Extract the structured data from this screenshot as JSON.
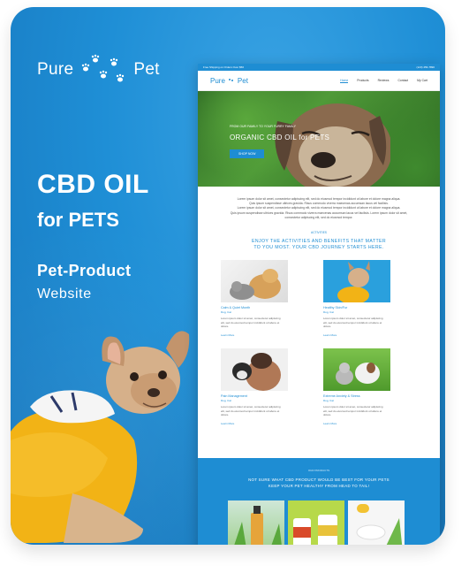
{
  "promo": {
    "logo_word1": "Pure",
    "logo_word2": "Pet",
    "headline1": "CBD OIL",
    "headline2": "for PETS",
    "sub1": "Pet-Product",
    "sub2": "Website"
  },
  "site": {
    "topbar_left": "Free Shipping on Orders Over $50",
    "topbar_right": "(123) 456-7890",
    "brand1": "Pure",
    "brand2": "Pet",
    "nav": [
      "Home",
      "Products",
      "Reviews",
      "Contact",
      "My Cart"
    ],
    "hero_small": "FROM OUR FAMILY TO YOUR FURRY FAMILY",
    "hero_big": "ORGANIC CBD OIL for PETS",
    "hero_button": "SHOP NOW",
    "intro": [
      "Lorem ipsum dolor sit amet, consectetur adipiscing elit, sed do eiusmod tempor incididunt ut labore et dolore magna aliqua.",
      "Quis ipsum suspendisse ultrices gravida. Risus commodo viverra maecenas accumsan lacus vel facilisis.",
      "Lorem ipsum dolor sit amet, consectetur adipiscing elit, sed do eiusmod tempor incididunt ut labore et dolore magna aliqua.",
      "Quis ipsum suspendisse ultrices gravida. Risus commodo viverra maecenas accumsan lacus vel facilisis. Lorem ipsum dolor sit amet, consectetur adipiscing elit, sed do eiusmod tempor."
    ],
    "section_label": "ACTIVITIES",
    "section_title_1": "ENJOY THE ACTIVITIES AND BENEFITS THAT MATTER",
    "section_title_2": "TO YOU MOST. YOUR CBD JOURNEY STARTS HERE.",
    "items": [
      {
        "title": "Calm & Quiet Month",
        "cat": "Dog, Cat",
        "desc": "Lorem ipsum dolor sit amet, consectetur adipiscing elit, sed do eiusmod tempor incididunt ut labore et dolore.",
        "more": "Learn More"
      },
      {
        "title": "Healthy Skin/Fur",
        "cat": "Dog, Cat",
        "desc": "Lorem ipsum dolor sit amet, consectetur adipiscing elit, sed do eiusmod tempor incididunt ut labore et dolore.",
        "more": "Learn More"
      },
      {
        "title": "Pain Management",
        "cat": "Dog, Cat",
        "desc": "Lorem ipsum dolor sit amet, consectetur adipiscing elit, sed do eiusmod tempor incididunt ut labore et dolore.",
        "more": "Learn More"
      },
      {
        "title": "Extreme Anxiety & Stress",
        "cat": "Dog, Cat",
        "desc": "Lorem ipsum dolor sit amet, consectetur adipiscing elit, sed do eiusmod tempor incididunt ut labore et dolore.",
        "more": "Learn More"
      }
    ],
    "band_label": "OUR PRODUCTS",
    "band_title_1": "NOT SURE WHAT CBD PRODUCT WOULD BE BEST FOR YOUR PETS",
    "band_title_2": "KEEP YOUR PET HEALTHY FROM HEAD TO TAIL!"
  },
  "colors": {
    "accent": "#1e8dd3",
    "background": "#1f8fd6"
  }
}
